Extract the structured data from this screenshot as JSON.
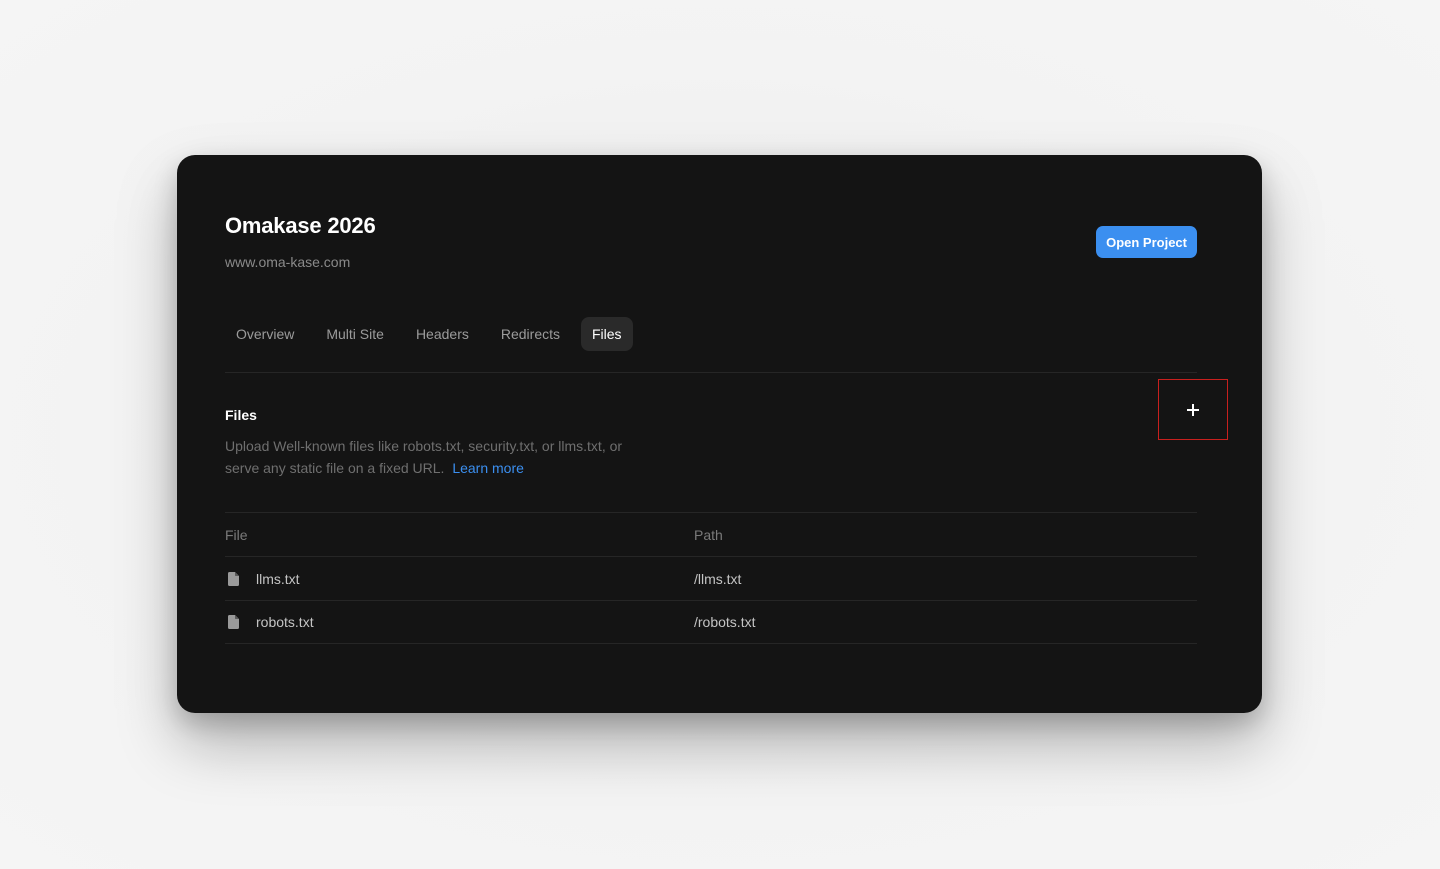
{
  "project": {
    "title": "Omakase 2026",
    "url": "www.oma-kase.com",
    "open_label": "Open Project"
  },
  "tabs": [
    {
      "label": "Overview",
      "active": false
    },
    {
      "label": "Multi Site",
      "active": false
    },
    {
      "label": "Headers",
      "active": false
    },
    {
      "label": "Redirects",
      "active": false
    },
    {
      "label": "Files",
      "active": true
    }
  ],
  "files_section": {
    "title": "Files",
    "description": "Upload Well-known files like robots.txt, security.txt, or llms.txt, or serve any static file on a fixed URL.",
    "learn_more": "Learn more",
    "add_icon": "plus-icon"
  },
  "table": {
    "columns": [
      "File",
      "Path"
    ],
    "rows": [
      {
        "icon": "file-icon",
        "file": "llms.txt",
        "path": "/llms.txt"
      },
      {
        "icon": "file-icon",
        "file": "robots.txt",
        "path": "/robots.txt"
      }
    ]
  },
  "colors": {
    "panel_bg": "#141414",
    "accent": "#3b8ff0",
    "highlight_border": "#c8201e"
  }
}
